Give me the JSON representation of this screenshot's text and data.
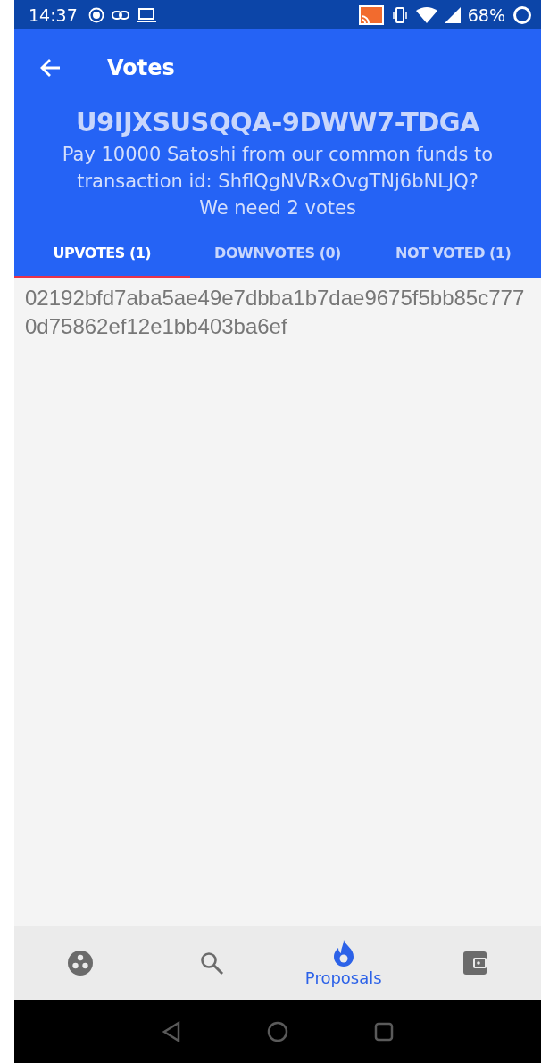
{
  "status_bar": {
    "time": "14:37",
    "battery": "68%"
  },
  "app_bar": {
    "title": "Votes"
  },
  "proposal": {
    "title": "U9IJXSUSQQA-9DWW7-TDGA",
    "description": "Pay 10000 Satoshi from our common funds to transaction id: ShflQgNVRxOvgTNj6bNLJQ?",
    "requirement": "We need 2 votes"
  },
  "tabs": [
    {
      "label": "UPVOTES (1)",
      "selected": true
    },
    {
      "label": "DOWNVOTES (0)",
      "selected": false
    },
    {
      "label": "NOT VOTED (1)",
      "selected": false
    }
  ],
  "voters": [
    "02192bfd7aba5ae49e7dbba1b7dae9675f5bb85c7770d75862ef12e1bb403ba6ef"
  ],
  "bottom_nav": [
    {
      "kind": "community",
      "selected": false
    },
    {
      "kind": "search",
      "selected": false
    },
    {
      "kind": "proposals",
      "label": "Proposals",
      "selected": true
    },
    {
      "kind": "wallet",
      "selected": false
    }
  ]
}
